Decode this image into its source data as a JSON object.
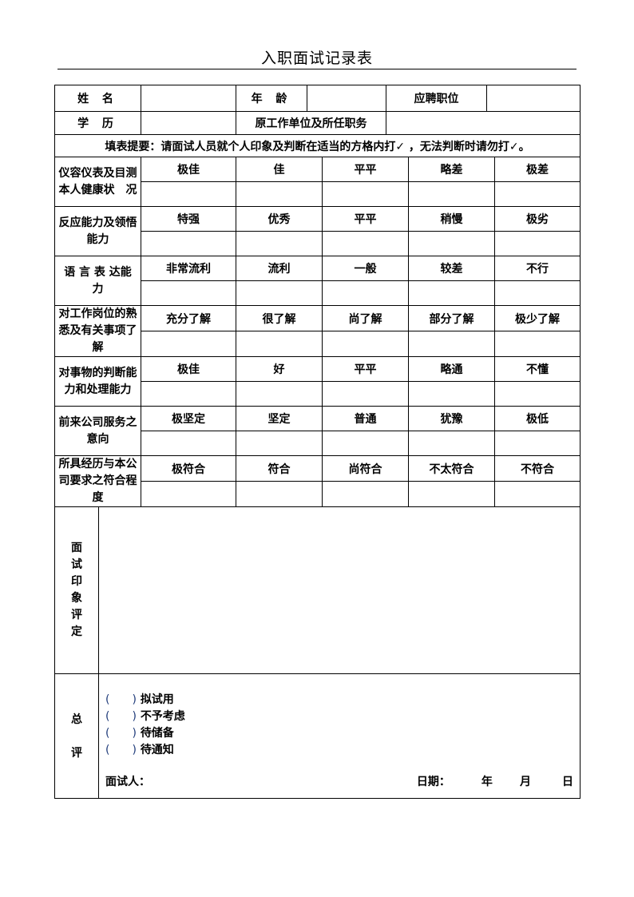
{
  "title": "入职面试记录表",
  "basic_info": {
    "name_label": "姓 名",
    "age_label": "年 龄",
    "position_label": "应聘职位",
    "education_label": "学 历",
    "former_employer_label": "原工作单位及所任职务",
    "name_value": "",
    "age_value": "",
    "position_value": "",
    "education_value": "",
    "former_employer_value": ""
  },
  "hint": "填表提要：请面试人员就个人印象及判断在适当的方格内打✓ ，无法判断时请勿打✓。",
  "ratings": [
    {
      "criterion": "仪容仪表及目测本人健康状　况",
      "options": [
        "极佳",
        "佳",
        "平平",
        "略差",
        "极差"
      ]
    },
    {
      "criterion": "反应能力及领悟能力",
      "options": [
        "特强",
        "优秀",
        "平平",
        "稍慢",
        "极劣"
      ]
    },
    {
      "criterion": "语 言 表 达能　力",
      "options": [
        "非常流利",
        "流利",
        "一般",
        "较差",
        "不行"
      ]
    },
    {
      "criterion": "对工作岗位的熟悉及有关事项了解",
      "options": [
        "充分了解",
        "很了解",
        "尚了解",
        "部分了解",
        "极少了解"
      ]
    },
    {
      "criterion": "对事物的判断能力和处理能力",
      "options": [
        "极佳",
        "好",
        "平平",
        "略通",
        "不懂"
      ]
    },
    {
      "criterion": "前来公司服务之意向",
      "options": [
        "极坚定",
        "坚定",
        "普通",
        "犹豫",
        "极低"
      ]
    },
    {
      "criterion": "所具经历与本公司要求之符合程度",
      "options": [
        "极符合",
        "符合",
        "尚符合",
        "不太符合",
        "不符合"
      ]
    }
  ],
  "impression": {
    "label_chars": [
      "面",
      "试",
      "印",
      "象",
      "评",
      "定"
    ],
    "value": ""
  },
  "summary": {
    "label_chars": [
      "总",
      "评"
    ],
    "options": [
      {
        "paren": "(　　)",
        "label": "拟试用"
      },
      {
        "paren": "(　　)",
        "label": "不予考虑"
      },
      {
        "paren": "(　　)",
        "label": "待储备"
      },
      {
        "paren": "(　　)",
        "label": "待通知"
      }
    ],
    "interviewer_label": "面试人：",
    "date_label": "日期：",
    "year_label": "年",
    "month_label": "月",
    "day_label": "日"
  }
}
